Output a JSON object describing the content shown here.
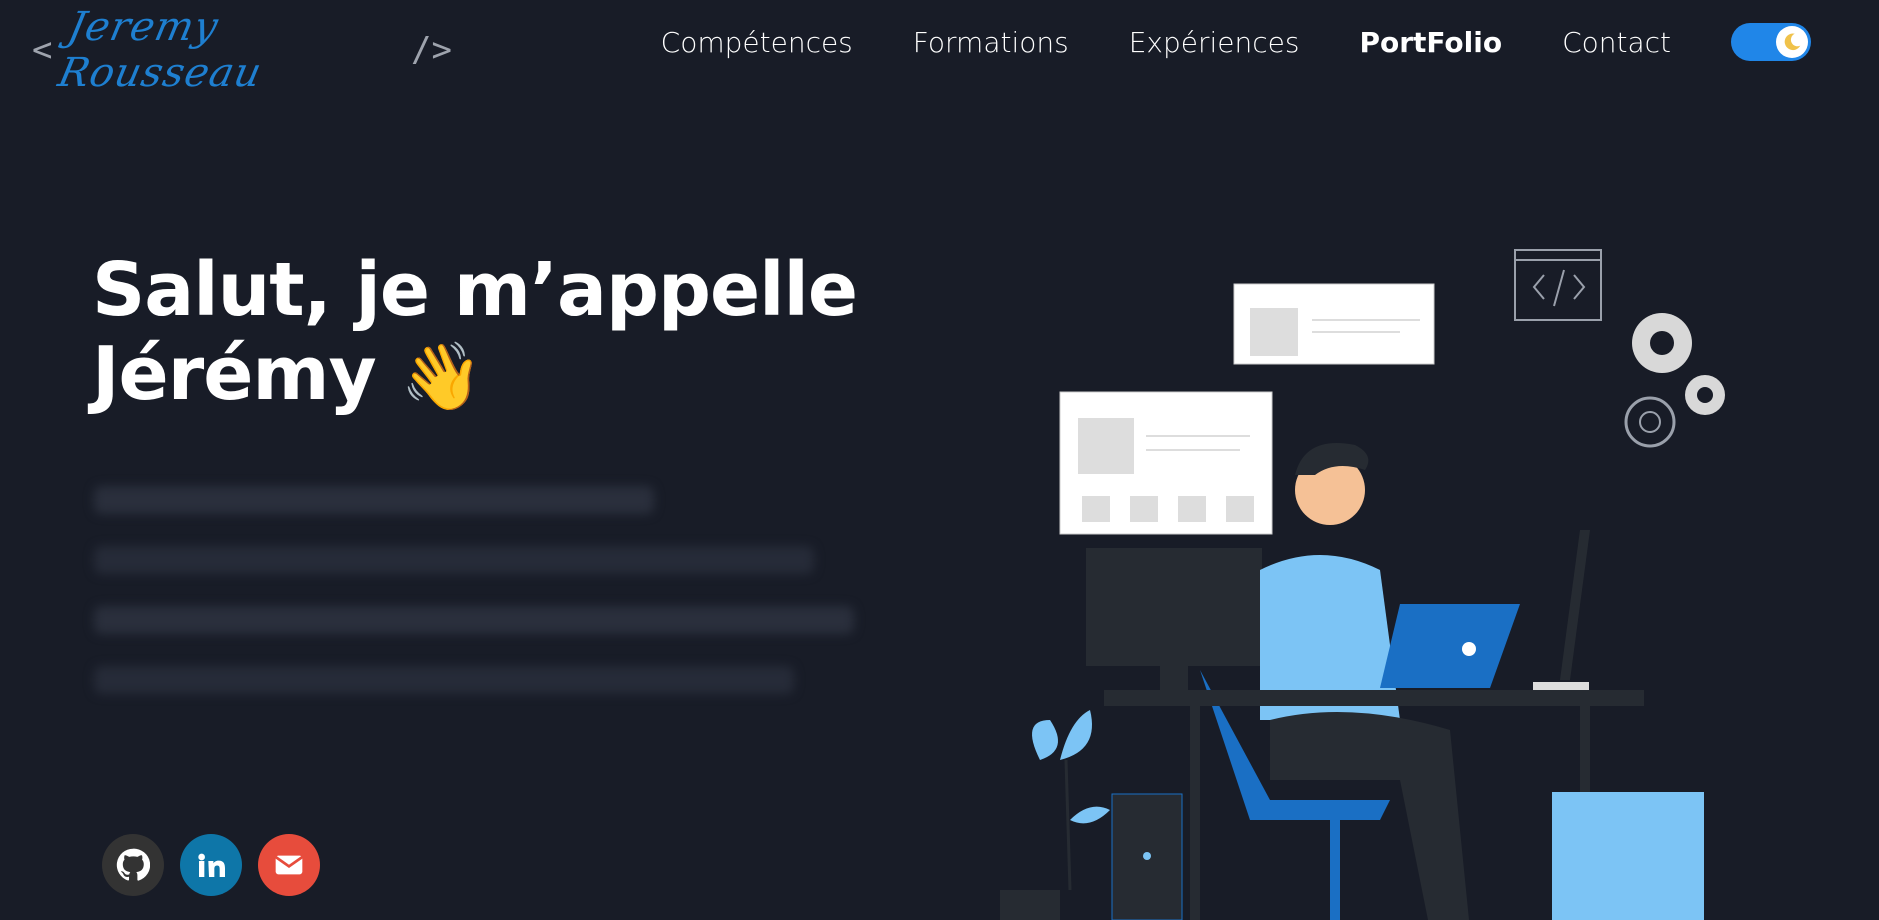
{
  "logo": {
    "open_bracket": "<",
    "signature": "Jeremy Rousseau",
    "close_bracket": "/>"
  },
  "nav": {
    "items": [
      {
        "label": "Compétences"
      },
      {
        "label": "Formations"
      },
      {
        "label": "Expériences"
      },
      {
        "label": "PortFolio",
        "active": true
      },
      {
        "label": "Contact"
      }
    ],
    "theme_toggle": {
      "state": "dark",
      "icon": "moon-icon"
    }
  },
  "hero": {
    "title_line1": "Salut, je m’appelle",
    "title_line2": "Jérémy",
    "wave_emoji": "👋"
  },
  "socials": [
    {
      "name": "github",
      "icon": "github-icon",
      "color": "#333333"
    },
    {
      "name": "linkedin",
      "icon": "linkedin-icon",
      "color": "#0e76a8"
    },
    {
      "name": "mail",
      "icon": "mail-icon",
      "color": "#e74c3c"
    }
  ],
  "colors": {
    "background": "#181c27",
    "accent": "#2086e8",
    "logo": "#1e7fd0"
  }
}
